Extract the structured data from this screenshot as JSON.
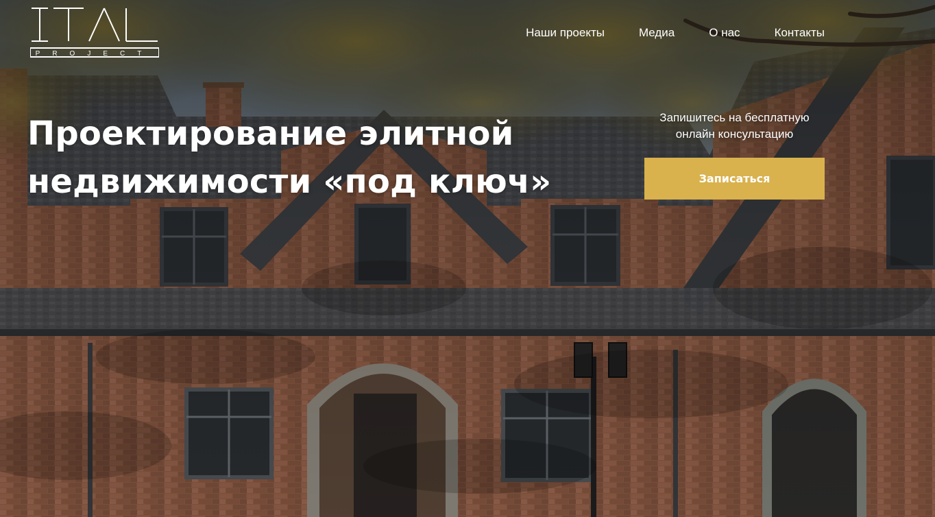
{
  "header": {
    "logo": {
      "wordmark": "ITAL",
      "sub": "PROJECT"
    },
    "nav": [
      {
        "label": "Наши проекты"
      },
      {
        "label": "Медиа"
      },
      {
        "label": "О нас"
      },
      {
        "label": "Контакты"
      }
    ]
  },
  "hero": {
    "headline_line1": "Проектирование элитной",
    "headline_line2": "недвижимости «под ключ»"
  },
  "cta": {
    "text_line1": "Запишитесь на бесплатную",
    "text_line2": "онлайн консультацию",
    "button_label": "Записаться"
  },
  "colors": {
    "accent": "#d9b24e",
    "text": "#ffffff"
  }
}
